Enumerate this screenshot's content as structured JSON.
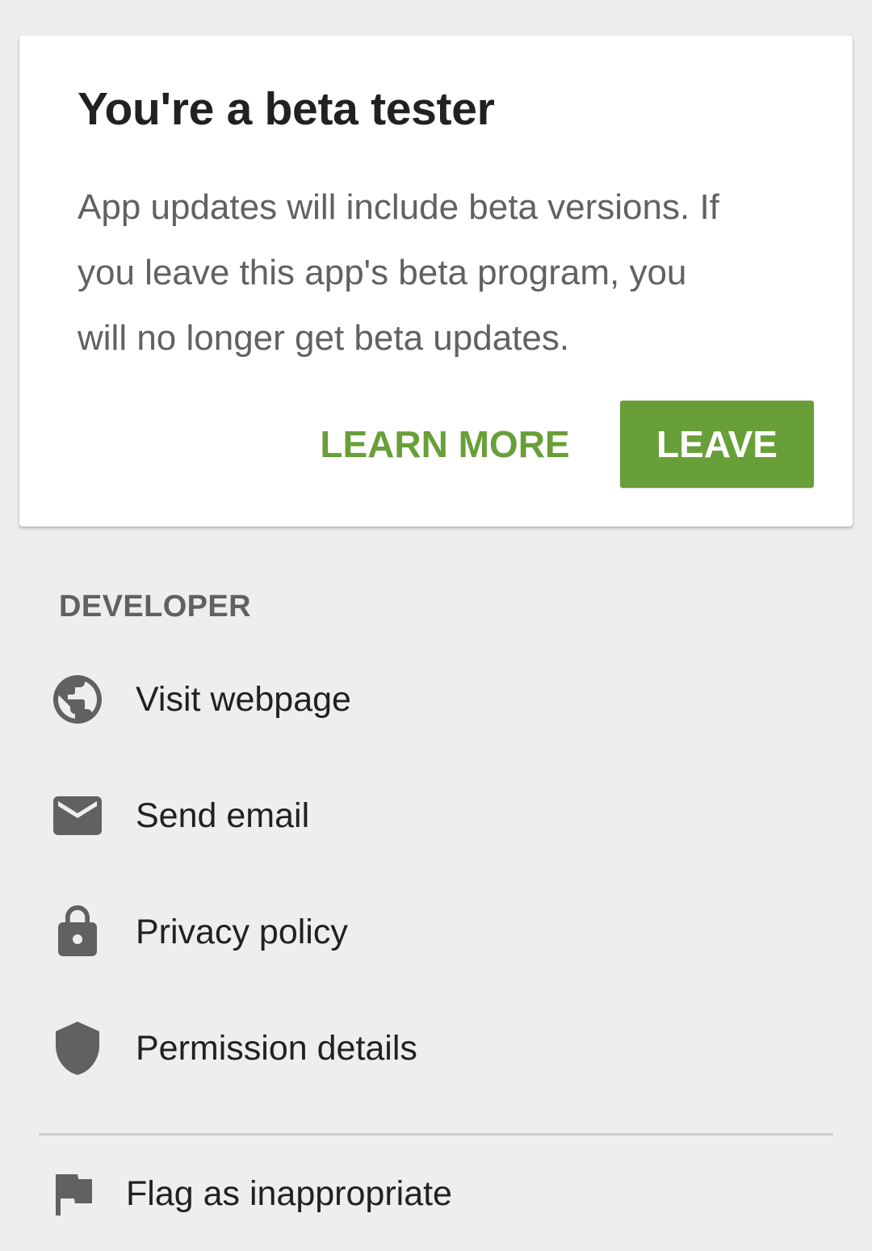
{
  "beta_card": {
    "title": "You're a beta tester",
    "body_lines": [
      "App updates will include beta versions. If",
      "you leave this app's beta program, you",
      "will no longer get beta updates."
    ],
    "learn_more_label": "LEARN MORE",
    "leave_label": "LEAVE"
  },
  "developer": {
    "header": "DEVELOPER",
    "items": [
      {
        "icon": "globe-icon",
        "label": "Visit webpage"
      },
      {
        "icon": "email-icon",
        "label": "Send email"
      },
      {
        "icon": "lock-icon",
        "label": "Privacy policy"
      },
      {
        "icon": "shield-icon",
        "label": "Permission details"
      }
    ]
  },
  "flag": {
    "icon": "flag-icon",
    "label": "Flag as inappropriate"
  },
  "colors": {
    "accent_green": "#689f38",
    "background": "#eeeeee",
    "card": "#ffffff",
    "icon_gray": "#616161"
  }
}
